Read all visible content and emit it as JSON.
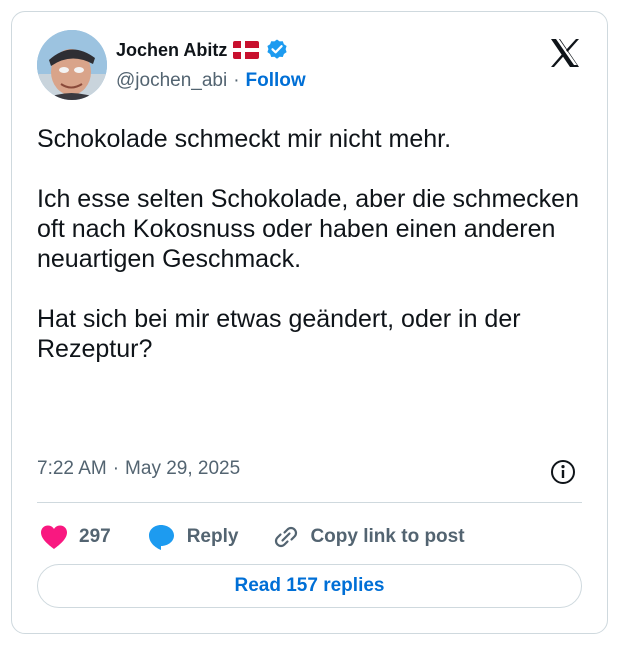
{
  "author": {
    "name": "Jochen Abitz",
    "handle": "@jochen_abi",
    "separator": "·",
    "follow_label": "Follow",
    "flag_icon": "denmark-flag-icon",
    "verified_icon": "verified-badge-icon"
  },
  "brand": {
    "logo_icon": "x-logo-icon"
  },
  "tweet": {
    "paragraphs": [
      "Schokolade schmeckt mir nicht mehr.",
      "Ich esse selten Schokolade, aber  die schmecken oft nach Kokosnuss oder haben einen anderen neuartigen Geschmack.",
      "Hat sich bei mir etwas geändert, oder in der Rezeptur?"
    ],
    "time": "7:22 AM",
    "meta_separator": "·",
    "date": "May 29, 2025"
  },
  "actions": {
    "like_count": "297",
    "reply_label": "Reply",
    "copy_label": "Copy link to post"
  },
  "read_replies_label": "Read 157 replies",
  "colors": {
    "accent": "#006fd6",
    "like": "#f91880",
    "verified": "#1d9bf0",
    "text_primary": "#0f1419",
    "text_secondary": "#536471",
    "border": "#cfd9de",
    "flag_red": "#c8102e"
  }
}
